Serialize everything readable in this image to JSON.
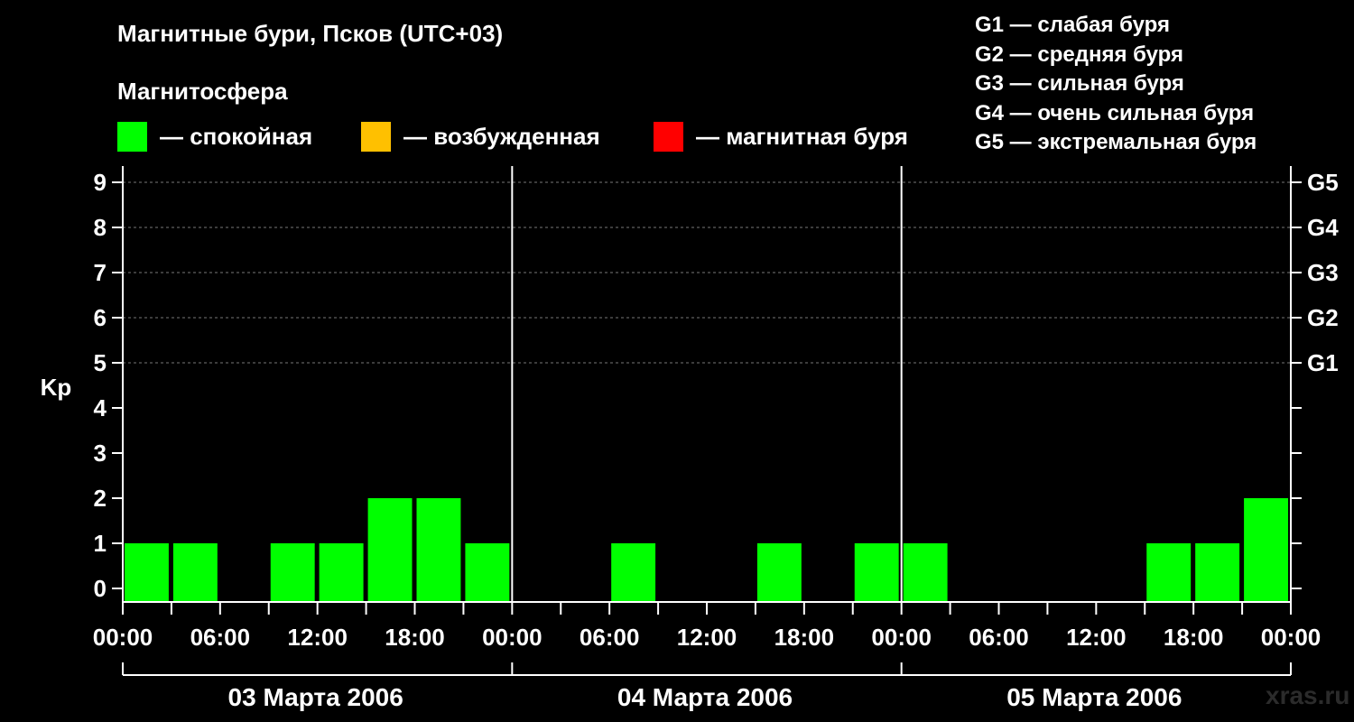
{
  "title": "Магнитные бури, Псков (UTC+03)",
  "subtitle": "Магнитосфера",
  "legend": [
    {
      "label": "— спокойная",
      "color": "#00ff00"
    },
    {
      "label": "— возбужденная",
      "color": "#ffc000"
    },
    {
      "label": "— магнитная буря",
      "color": "#ff0000"
    }
  ],
  "g_legend": [
    "G1 — слабая буря",
    "G2 — средняя буря",
    "G3 — сильная буря",
    "G4 — очень сильная буря",
    "G5 — экстремальная буря"
  ],
  "watermark": "xras.ru",
  "chart_data": {
    "type": "bar",
    "ylabel": "Kp",
    "ylim": [
      0,
      9
    ],
    "y_ticks": [
      "0",
      "1",
      "2",
      "3",
      "4",
      "5",
      "6",
      "7",
      "8",
      "9"
    ],
    "right_ticks": [
      {
        "kp": 5,
        "label": "G1"
      },
      {
        "kp": 6,
        "label": "G2"
      },
      {
        "kp": 7,
        "label": "G3"
      },
      {
        "kp": 8,
        "label": "G4"
      },
      {
        "kp": 9,
        "label": "G5"
      }
    ],
    "x_tick_labels": [
      "00:00",
      "06:00",
      "12:00",
      "18:00",
      "00:00",
      "06:00",
      "12:00",
      "18:00",
      "00:00",
      "06:00",
      "12:00",
      "18:00",
      "00:00"
    ],
    "days": [
      "03 Марта 2006",
      "04 Марта 2006",
      "05 Марта 2006"
    ],
    "series": [
      {
        "values": [
          1,
          1,
          0,
          1,
          1,
          2,
          2,
          1,
          0,
          0,
          1,
          0,
          0,
          1,
          0,
          1,
          1,
          0,
          0,
          0,
          0,
          1,
          1,
          2
        ]
      }
    ],
    "bar_color": "#00ff00",
    "grid": true
  }
}
